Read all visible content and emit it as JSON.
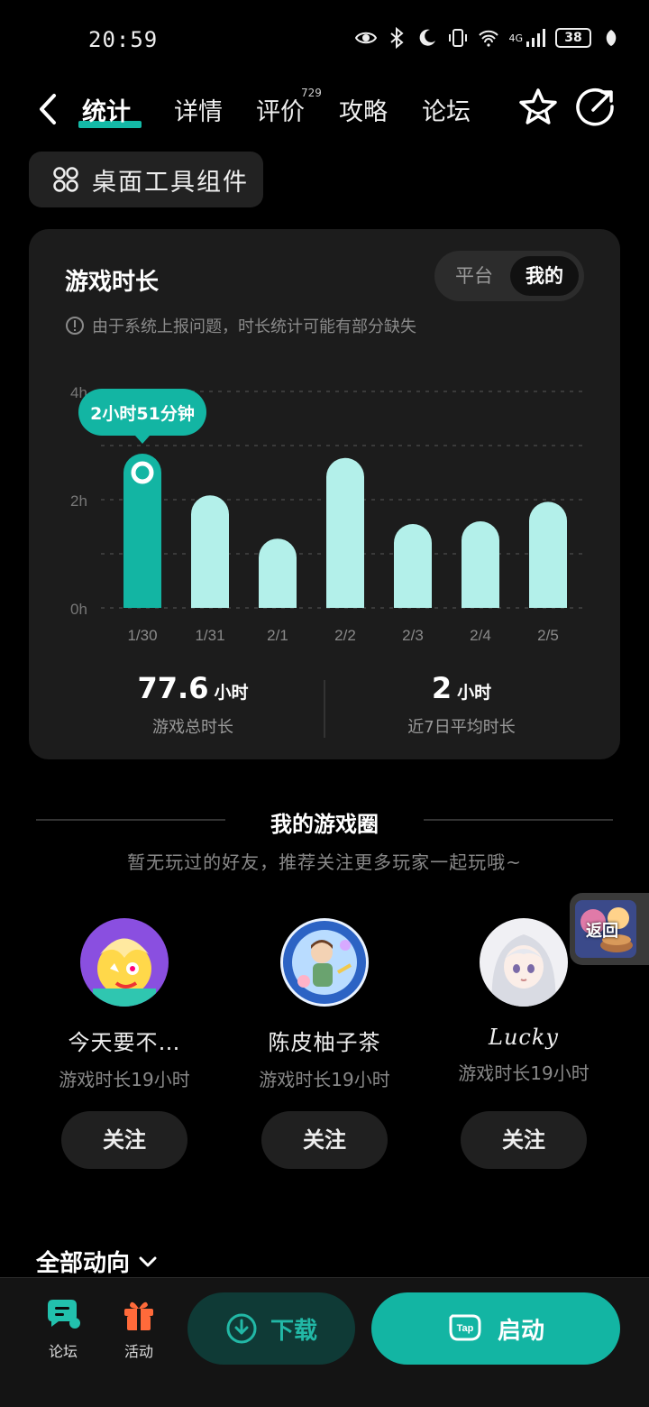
{
  "status_bar": {
    "time": "20:59",
    "network": "4G",
    "battery": "38"
  },
  "nav": {
    "tabs": [
      {
        "label": "统计"
      },
      {
        "label": "详情"
      },
      {
        "label": "评价"
      },
      {
        "label": "攻略"
      },
      {
        "label": "论坛"
      }
    ],
    "review_count": "729"
  },
  "widget_button": {
    "label": "桌面工具组件"
  },
  "stats_card": {
    "title": "游戏时长",
    "segments": [
      "平台",
      "我的"
    ],
    "notice": "由于系统上报问题，时长统计可能有部分缺失",
    "tooltip": "2小时51分钟",
    "total": {
      "value": "77.6",
      "unit": "小时",
      "label": "游戏总时长"
    },
    "average": {
      "value": "2",
      "unit": "小时",
      "label": "近7日平均时长"
    }
  },
  "chart_data": {
    "type": "bar",
    "categories": [
      "1/30",
      "1/31",
      "2/1",
      "2/2",
      "2/3",
      "2/4",
      "2/5"
    ],
    "values": [
      2.85,
      2.08,
      1.28,
      2.77,
      1.55,
      1.6,
      1.96
    ],
    "ylim": [
      0,
      4
    ],
    "yticks": [
      "0h",
      "2h",
      "4h"
    ],
    "selected_index": 0,
    "colors": {
      "selected": "#13b5a3",
      "default": "#b3f0ea"
    }
  },
  "game_circle": {
    "title": "我的游戏圈",
    "subtitle": "暂无玩过的好友，推荐关注更多玩家一起玩哦~",
    "friends": [
      {
        "name": "今天要不…",
        "time": "游戏时长19小时",
        "follow": "关注"
      },
      {
        "name": "陈皮柚子茶",
        "time": "游戏时长19小时",
        "follow": "关注"
      },
      {
        "name": "Lucky",
        "time": "游戏时长19小时",
        "follow": "关注"
      }
    ],
    "back_label": "返回"
  },
  "feed": {
    "label": "全部动向"
  },
  "bottom_bar": {
    "forum": "论坛",
    "activity": "活动",
    "download": "下载",
    "launch": "启动",
    "launch_logo": "Tap"
  }
}
